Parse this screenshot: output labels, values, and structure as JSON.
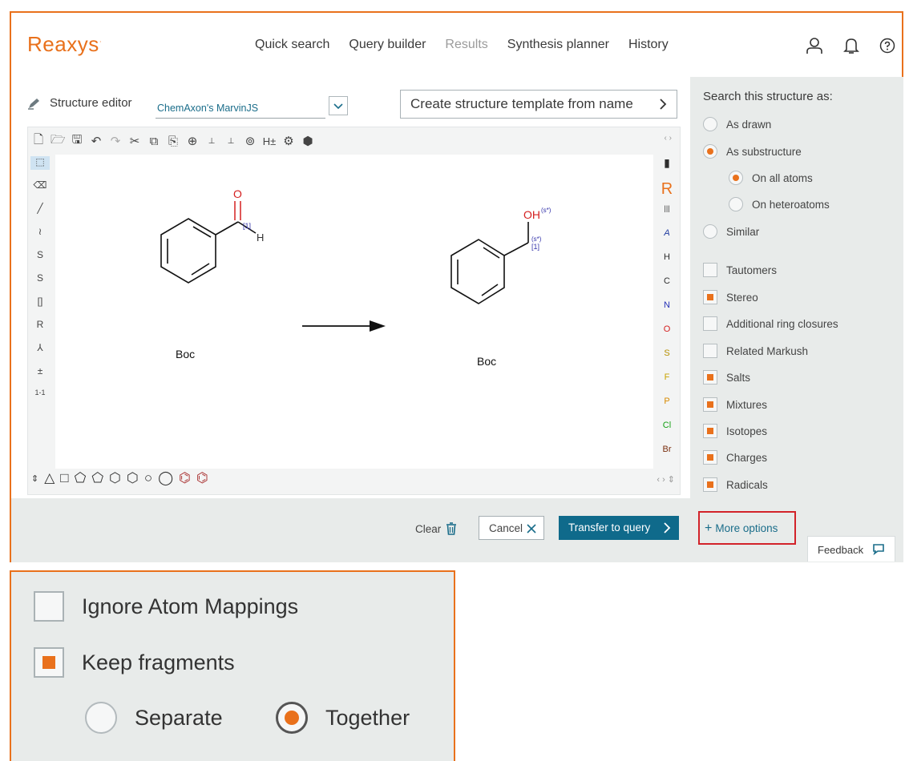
{
  "header": {
    "logo": "Reaxys",
    "logo_mark": "·",
    "nav": [
      "Quick search",
      "Query builder",
      "Results",
      "Synthesis planner",
      "History"
    ]
  },
  "editor": {
    "title": "Structure editor",
    "engine_select": "ChemAxon's MarvinJS",
    "template_button": "Create structure template from name",
    "molecule_labels": {
      "left_o": "O",
      "left_map": "[1]",
      "left_h": "H",
      "left_boc": "Boc",
      "right_oh": "OH",
      "right_oh_sup": "(s*)",
      "right_map": "[1]",
      "right_map_sup": "(s*)",
      "right_boc": "Boc"
    },
    "element_buttons": [
      "R",
      "A",
      "H",
      "C",
      "N",
      "O",
      "S",
      "F",
      "P",
      "Cl",
      "Br"
    ],
    "left_tool_text": [
      "S",
      "S",
      "[]",
      "R",
      "1-1"
    ]
  },
  "actions": {
    "clear": "Clear",
    "cancel": "Cancel",
    "transfer": "Transfer to query"
  },
  "options": {
    "header": "Search this structure as:",
    "as_drawn": "As drawn",
    "as_substructure": "As substructure",
    "on_all_atoms": "On all atoms",
    "on_heteroatoms": "On heteroatoms",
    "similar": "Similar",
    "tautomers": "Tautomers",
    "stereo": "Stereo",
    "additional_ring_closures": "Additional ring closures",
    "related_markush": "Related Markush",
    "salts": "Salts",
    "mixtures": "Mixtures",
    "isotopes": "Isotopes",
    "charges": "Charges",
    "radicals": "Radicals",
    "more_options": "More options",
    "feedback": "Feedback"
  },
  "inset": {
    "ignore_atom_mappings": "Ignore Atom Mappings",
    "keep_fragments": "Keep fragments",
    "separate": "Separate",
    "together": "Together"
  },
  "colors": {
    "accent": "#e9711c",
    "link": "#1a6d8a",
    "primary_button": "#0f6a8b",
    "highlight_border": "#d2232a",
    "oxygen": "#d42020",
    "mapping": "#3333aa"
  }
}
